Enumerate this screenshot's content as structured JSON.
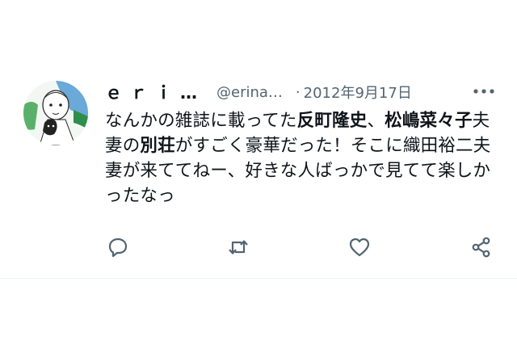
{
  "user": {
    "display_name": "ｅｒｉ…",
    "handle": "@erina…",
    "separator": "·",
    "date": "2012年9月17日"
  },
  "tweet": {
    "segments": [
      {
        "text": "なんかの雑誌に載ってた",
        "bold": false
      },
      {
        "text": "反町隆史",
        "bold": true
      },
      {
        "text": "、",
        "bold": false
      },
      {
        "text": "松嶋菜々子",
        "bold": true
      },
      {
        "text": "夫妻の",
        "bold": false
      },
      {
        "text": "別荘",
        "bold": true
      },
      {
        "text": "がすごく豪華だった！そこに織田裕二夫妻が来ててねー、好きな人ばっかで見てて楽しかったなっ",
        "bold": false
      }
    ]
  },
  "icons": {
    "more": "more-dots-icon",
    "reply": "reply-icon",
    "retweet": "retweet-icon",
    "like": "heart-icon",
    "share": "share-icon"
  },
  "colors": {
    "text": "#0f1419",
    "secondary": "#536471",
    "divider": "#eff3f4"
  }
}
